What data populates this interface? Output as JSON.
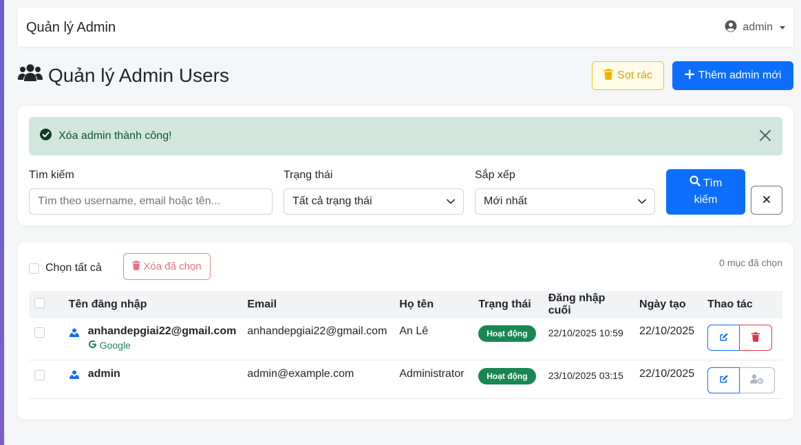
{
  "app": {
    "brand": "Quản lý Admin",
    "user": "admin"
  },
  "header": {
    "title": "Quản lý Admin Users",
    "trash_label": "Sọt rác",
    "add_label": "Thêm admin mới"
  },
  "alert": {
    "message": "Xóa admin thành công!"
  },
  "filters": {
    "search_label": "Tìm kiếm",
    "search_placeholder": "Tìm theo username, email hoặc tên...",
    "status_label": "Trạng thái",
    "status_value": "Tất cả trạng thái",
    "sort_label": "Sắp xếp",
    "sort_value": "Mới nhất",
    "search_button_line1": "Tìm",
    "search_button_line2": "kiếm"
  },
  "toolbar": {
    "select_all_label": "Chọn tất cả",
    "delete_selected_label": "Xóa đã chọn",
    "selected_count": "0 mục đã chọn"
  },
  "table": {
    "headers": [
      "Tên đăng nhập",
      "Email",
      "Họ tên",
      "Trạng thái",
      "Đăng nhập cuối",
      "Ngày tạo",
      "Thao tác"
    ],
    "rows": [
      {
        "username": "anhandepgiai22@gmail.com",
        "provider": "Google",
        "email": "anhandepgiai22@gmail.com",
        "full_name": "An Lê",
        "status": "Hoạt động",
        "last_login": "22/10/2025 10:59",
        "created": "22/10/2025"
      },
      {
        "username": "admin",
        "email": "admin@example.com",
        "full_name": "Administrator",
        "status": "Hoạt động",
        "last_login": "23/10/2025 03:15",
        "created": "22/10/2025"
      }
    ]
  },
  "colors": {
    "primary": "#0d6efd",
    "success": "#198754",
    "danger": "#dc3545",
    "warning": "#f0c419",
    "alert_bg": "#d1e7dd"
  }
}
